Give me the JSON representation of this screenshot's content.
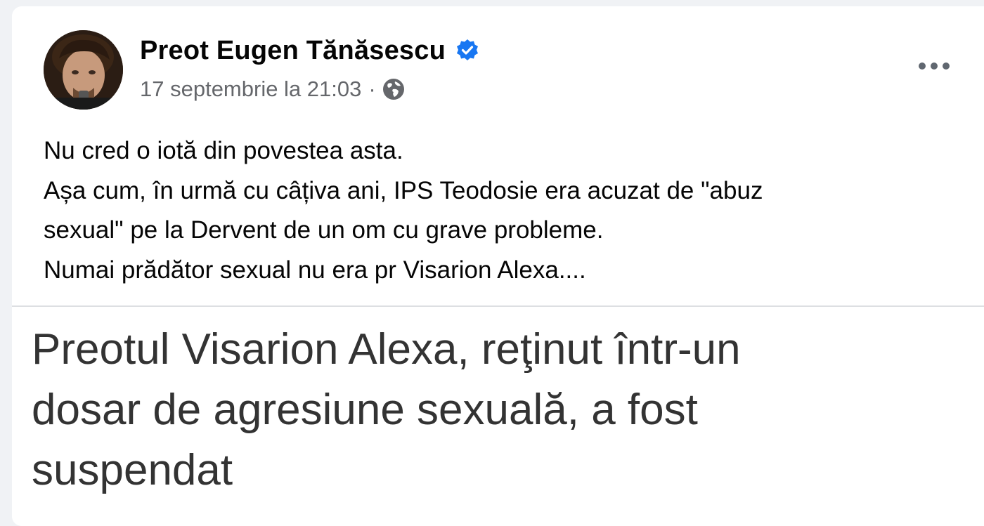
{
  "post": {
    "author": {
      "name": "Preot Eugen Tănăsescu",
      "verified": true
    },
    "timestamp": "17 septembrie la 21:03",
    "separator": "·",
    "audience_icon": "globe-icon",
    "more_icon": "more-options-icon",
    "text_lines": [
      "Nu cred o iotă din povestea asta.",
      "Așa cum, în urmă cu câțiva ani, IPS Teodosie era acuzat de \"abuz",
      "sexual\" pe la Dervent de un om cu grave probleme.",
      "Numai prădător sexual nu era pr Visarion Alexa...."
    ]
  },
  "link_preview": {
    "headline_lines": [
      "Preotul Visarion Alexa, reţinut într-un",
      "dosar de agresiune sexuală, a fost",
      "suspendat"
    ]
  },
  "colors": {
    "verified_badge": "#1877f2",
    "secondary_text": "#65676b",
    "primary_text": "#050505",
    "headline_text": "#333333"
  }
}
